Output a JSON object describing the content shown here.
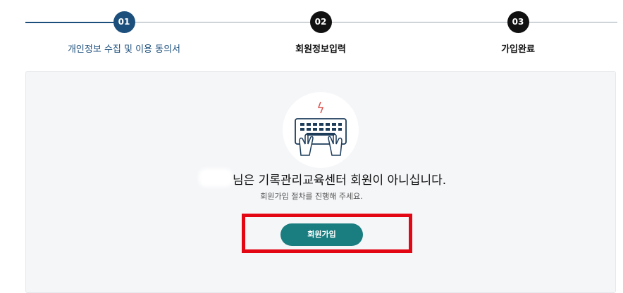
{
  "steps": [
    {
      "number": "01",
      "label": "개인정보 수집 및 이용 동의서",
      "active": true
    },
    {
      "number": "02",
      "label": "회원정보입력",
      "active": false
    },
    {
      "number": "03",
      "label": "가입완료",
      "active": false
    }
  ],
  "colors": {
    "active_step": "#1c4f7c",
    "inactive_step": "#111111",
    "button": "#1a7d80",
    "highlight": "#e30613"
  },
  "illustration": {
    "icon": "keyboard-typing-icon"
  },
  "message": {
    "main": "님은 기록관리교육센터 회원이 아니십니다.",
    "sub": "회원가입 절차를 진행해 주세요."
  },
  "join_button": {
    "label": "회원가입"
  }
}
